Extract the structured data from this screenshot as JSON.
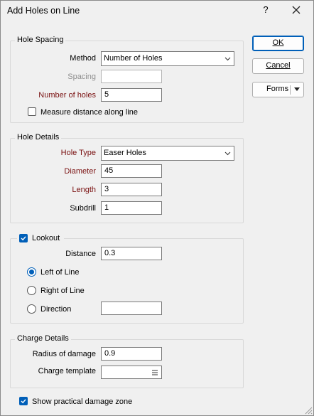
{
  "window": {
    "title": "Add Holes on Line"
  },
  "buttons": {
    "ok": "OK",
    "cancel": "Cancel",
    "forms": "Forms"
  },
  "hole_spacing": {
    "legend": "Hole Spacing",
    "method_label": "Method",
    "method_value": "Number of Holes",
    "spacing_label": "Spacing",
    "spacing_value": "",
    "number_label": "Number of holes",
    "number_value": "5",
    "measure_label": "Measure distance along line",
    "measure_checked": false
  },
  "hole_details": {
    "legend": "Hole Details",
    "type_label": "Hole Type",
    "type_value": "Easer Holes",
    "diameter_label": "Diameter",
    "diameter_value": "45",
    "length_label": "Length",
    "length_value": "3",
    "subdrill_label": "Subdrill",
    "subdrill_value": "1"
  },
  "lookout": {
    "legend": "Lookout",
    "checked": true,
    "distance_label": "Distance",
    "distance_value": "0.3",
    "options": [
      "Left of Line",
      "Right of Line",
      "Direction"
    ],
    "selected": "Left of Line",
    "direction_value": ""
  },
  "charge_details": {
    "legend": "Charge Details",
    "radius_label": "Radius of damage",
    "radius_value": "0.9",
    "template_label": "Charge template",
    "template_value": ""
  },
  "show_zone": {
    "label": "Show practical damage zone",
    "checked": true
  },
  "colors": {
    "accent": "#005fb8",
    "required_label": "#7a1111",
    "disabled_label": "#8f8f8f"
  }
}
